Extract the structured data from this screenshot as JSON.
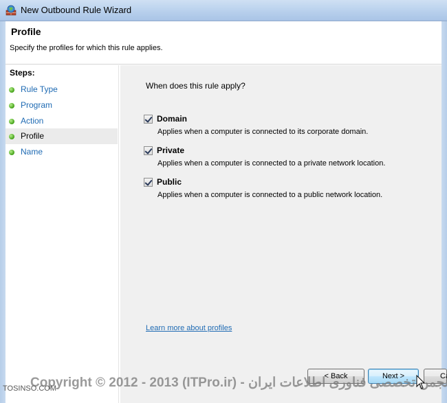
{
  "window": {
    "title": "New Outbound Rule Wizard",
    "icon": "firewall-shield-icon"
  },
  "header": {
    "title": "Profile",
    "subtitle": "Specify the profiles for which this rule applies."
  },
  "steps": {
    "heading": "Steps:",
    "items": [
      {
        "label": "Rule Type",
        "active": false
      },
      {
        "label": "Program",
        "active": false
      },
      {
        "label": "Action",
        "active": false
      },
      {
        "label": "Profile",
        "active": true
      },
      {
        "label": "Name",
        "active": false
      }
    ]
  },
  "main": {
    "question": "When does this rule apply?",
    "options": [
      {
        "label": "Domain",
        "description": "Applies when a computer is connected to its corporate domain.",
        "checked": true
      },
      {
        "label": "Private",
        "description": "Applies when a computer is connected to a private network location.",
        "checked": true
      },
      {
        "label": "Public",
        "description": "Applies when a computer is connected to a public network location.",
        "checked": true
      }
    ],
    "learn_more": "Learn more about profiles"
  },
  "buttons": {
    "back": "< Back",
    "next": "Next >",
    "cancel": "Ca"
  },
  "watermark": {
    "text": "Copyright © 2012 - 2013 (ITPro.ir) - انجمن تخصصی فناوری اطلاعات ایران",
    "site": "TOSINSO.COM"
  },
  "colors": {
    "link": "#1e6ab3",
    "step_dot": "#42a017",
    "content_bg": "#f0f0f0"
  }
}
